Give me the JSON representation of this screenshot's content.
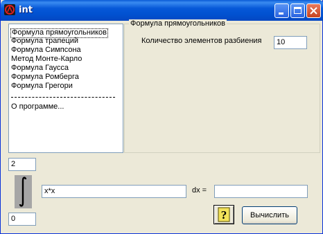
{
  "window": {
    "title": "int",
    "colors": {
      "titlebar": "#0658d8",
      "close_button": "#c8431e",
      "client": "#ece9d8"
    },
    "controls": [
      "minimize-icon",
      "maximize-icon",
      "close-icon"
    ]
  },
  "methods": {
    "items": [
      "Формула прямоугольников",
      "Формула трапеций",
      "Формула Симпсона",
      "Метод Монте-Карло",
      "Формула Гаусса",
      "Формула Ромберга",
      "Формула Грегори"
    ],
    "selected_index": 0,
    "about": "О программе..."
  },
  "settings": {
    "group_title": "Формула прямоугольников",
    "partition_label": "Количество элементов разбиения",
    "partition_value": "10"
  },
  "integral": {
    "upper_limit": "2",
    "lower_limit": "0",
    "integrand": "x*x",
    "dx_label": "dx  =",
    "result": ""
  },
  "actions": {
    "help_icon": "question-mark-icon",
    "calculate_label": "Вычислить"
  }
}
